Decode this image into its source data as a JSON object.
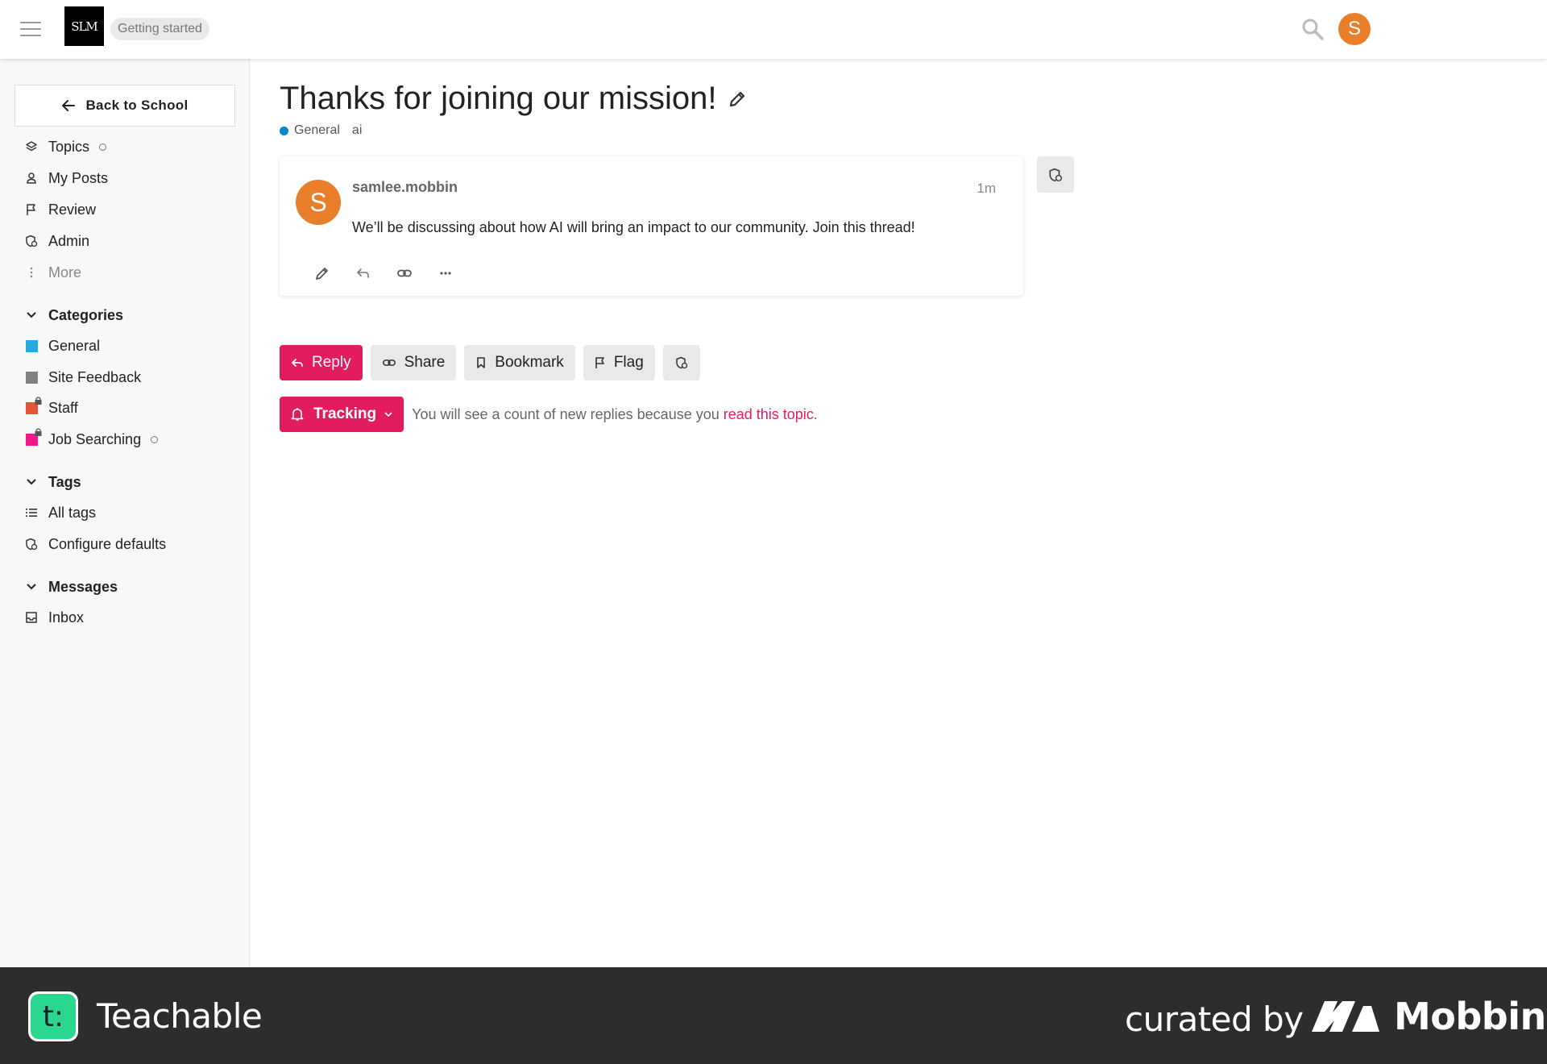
{
  "header": {
    "logo_text": "SLM",
    "badge": "Getting started",
    "avatar_letter": "S"
  },
  "sidebar": {
    "back_label": "Back to School",
    "nav": [
      {
        "label": "Topics",
        "icon": "layers-icon"
      },
      {
        "label": "My Posts",
        "icon": "user-icon"
      },
      {
        "label": "Review",
        "icon": "flag-icon"
      },
      {
        "label": "Admin",
        "icon": "shield-icon"
      },
      {
        "label": "More",
        "icon": "vertical-dots-icon"
      }
    ],
    "categories": {
      "heading": "Categories",
      "items": [
        {
          "label": "General",
          "color": "#25aae1"
        },
        {
          "label": "Site Feedback",
          "color": "#808281"
        },
        {
          "label": "Staff",
          "color": "#e45735"
        },
        {
          "label": "Job Searching",
          "color": "#f7168a"
        }
      ]
    },
    "tags": {
      "heading": "Tags",
      "items": [
        {
          "label": "All tags",
          "icon": "list-icon"
        },
        {
          "label": "Configure defaults",
          "icon": "shield-icon"
        }
      ]
    },
    "messages": {
      "heading": "Messages",
      "items": [
        {
          "label": "Inbox",
          "icon": "inbox-icon"
        }
      ]
    }
  },
  "topic": {
    "title": "Thanks for joining our mission!",
    "category": "General",
    "tag": "ai"
  },
  "post": {
    "avatar_letter": "S",
    "username": "samlee.mobbin",
    "time": "1m",
    "body": "We’ll be discussing about how AI will bring an impact to our community. Join this thread!"
  },
  "buttons": {
    "reply": "Reply",
    "share": "Share",
    "bookmark": "Bookmark",
    "flag": "Flag"
  },
  "tracking": {
    "label": "Tracking",
    "text": "You will see a count of new replies because you ",
    "link": "read this topic",
    "end": "."
  },
  "footer": {
    "brand_letter": "t:",
    "brand": "Teachable",
    "curated": "curated by",
    "mobbin": "Mobbin"
  },
  "colors": {
    "accent": "#e31c5f",
    "avatar": "#e87d2a",
    "general_dot": "#0088cc"
  }
}
